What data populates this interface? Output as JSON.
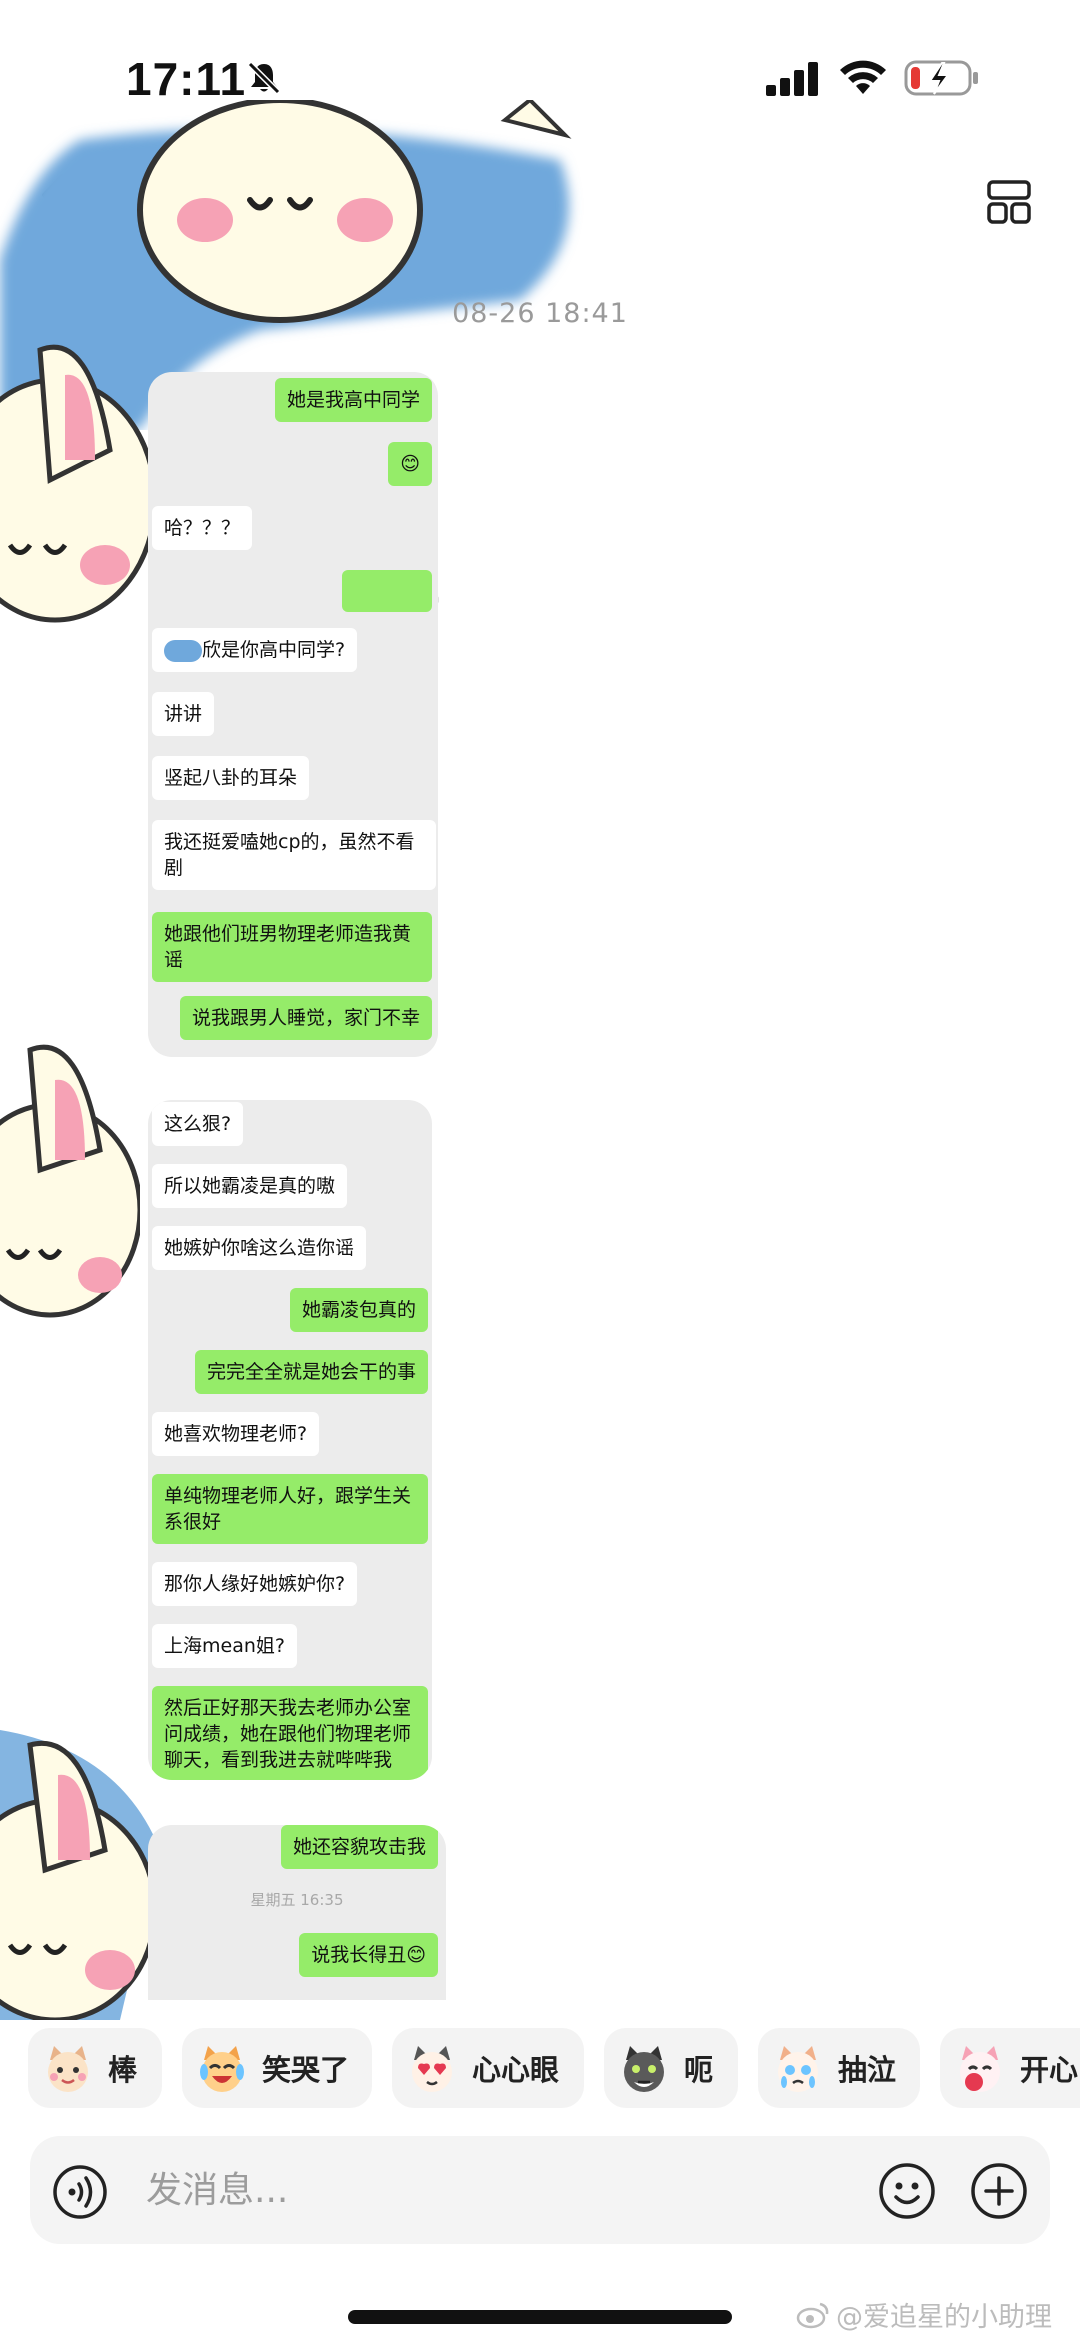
{
  "status_bar": {
    "time": "17:11"
  },
  "conversation": {
    "timestamp": "08-26 18:41"
  },
  "screenshot_1": {
    "messages": [
      {
        "side": "me",
        "text": "她是我高中同学"
      },
      {
        "side": "me",
        "text": "😊"
      },
      {
        "side": "them",
        "text": "哈？？？"
      },
      {
        "side": "me",
        "text": ""
      },
      {
        "side": "them",
        "text": "欣是你高中同学?"
      },
      {
        "side": "them",
        "text": "讲讲"
      },
      {
        "side": "them",
        "text": "竖起八卦的耳朵"
      },
      {
        "side": "them",
        "text": "我还挺爱嗑她cp的，虽然不看剧"
      },
      {
        "side": "me",
        "text": "她跟他们班男物理老师造我黄谣"
      },
      {
        "side": "me",
        "text": "说我跟男人睡觉，家门不幸"
      }
    ]
  },
  "screenshot_2": {
    "messages": [
      {
        "side": "them",
        "text": "这么狠?"
      },
      {
        "side": "them",
        "text": "所以她霸凌是真的嗷"
      },
      {
        "side": "them",
        "text": "她嫉妒你啥这么造你谣"
      },
      {
        "side": "me",
        "text": "她霸凌包真的"
      },
      {
        "side": "me",
        "text": "完完全全就是她会干的事"
      },
      {
        "side": "them",
        "text": "她喜欢物理老师?"
      },
      {
        "side": "me",
        "text": "单纯物理老师人好，跟学生关系很好"
      },
      {
        "side": "them",
        "text": "那你人缘好她嫉妒你?"
      },
      {
        "side": "them",
        "text": "上海mean姐?"
      },
      {
        "side": "me",
        "text": "然后正好那天我去老师办公室问成绩，她在跟他们物理老师聊天，看到我进去就哔哔我"
      }
    ]
  },
  "screenshot_3": {
    "messages": [
      {
        "side": "me",
        "text": "她还容貌攻击我"
      },
      {
        "side": "me",
        "text": "说我长得丑😊"
      }
    ],
    "time_label": "星期五 16:35"
  },
  "quick_reactions": [
    {
      "label": "棒",
      "icon": "cat-thumbs-icon"
    },
    {
      "label": "笑哭了",
      "icon": "cat-laugh-cry-icon"
    },
    {
      "label": "心心眼",
      "icon": "cat-heart-eyes-icon"
    },
    {
      "label": "呃",
      "icon": "cat-awkward-icon"
    },
    {
      "label": "抽泣",
      "icon": "cat-sob-icon"
    },
    {
      "label": "开心",
      "icon": "cat-happy-icon"
    }
  ],
  "composer": {
    "placeholder": "发消息..."
  },
  "watermark": {
    "text": "@爱追星的小助理"
  },
  "colors": {
    "sent_bubble": "#95ec69",
    "received_bubble": "#ffffff",
    "card_bg": "#ececec",
    "sticker_blue": "#6fa8dc"
  }
}
